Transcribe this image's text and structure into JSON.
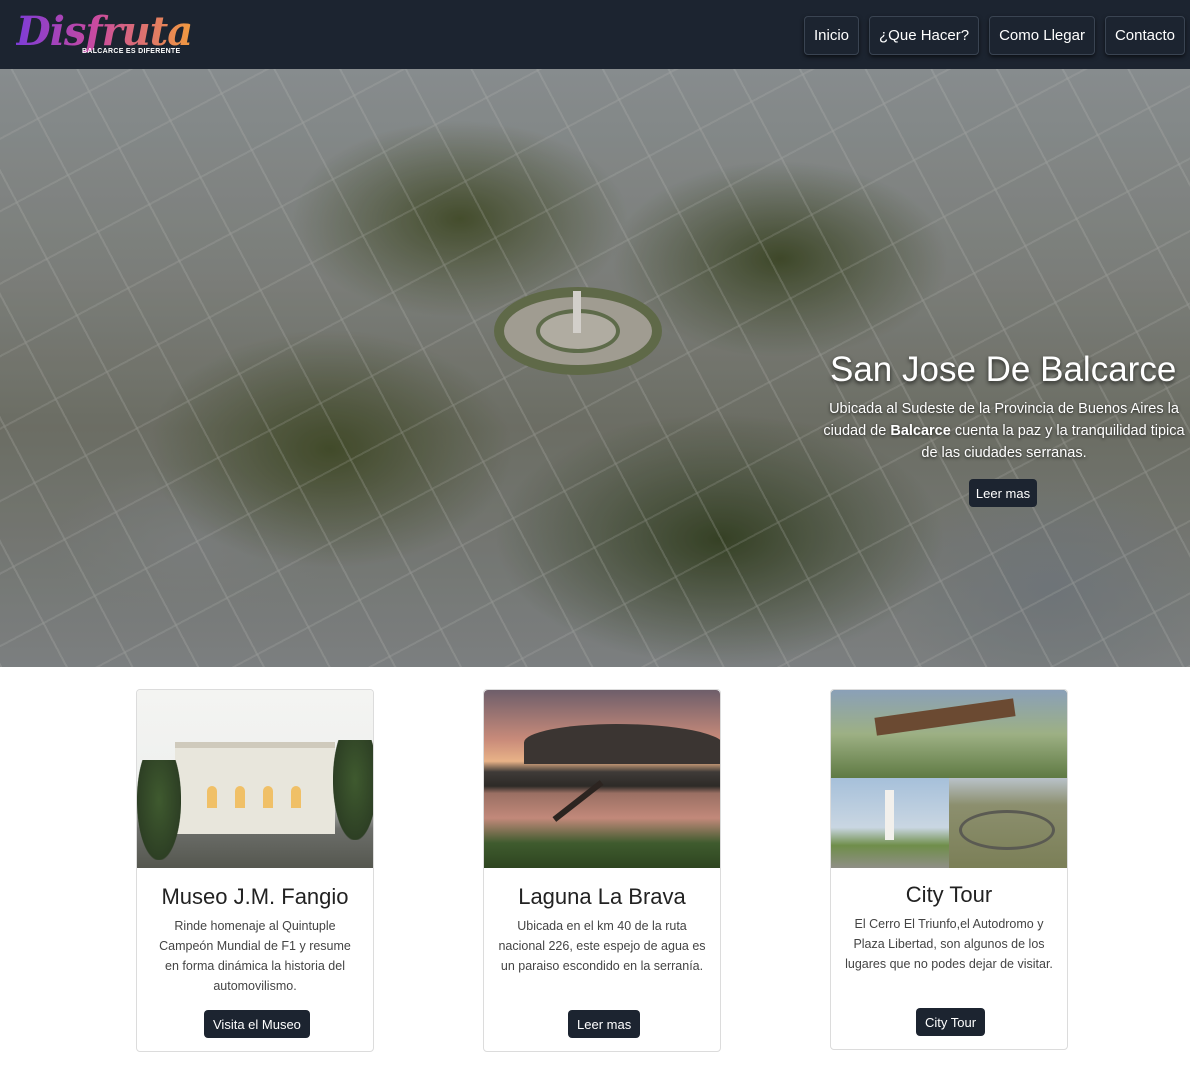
{
  "navbar": {
    "logo_text": "Disfruta",
    "logo_tagline": "BALCARCE ES DIFERENTE",
    "links": [
      "Inicio",
      "¿Que Hacer?",
      "Como Llegar",
      "Contacto"
    ]
  },
  "hero": {
    "title": "San Jose De Balcarce",
    "text_before": "Ubicada al Sudeste de la Provincia de Buenos Aires la ciudad de ",
    "text_bold": "Balcarce",
    "text_after": " cuenta la paz y la tranquilidad tipica de las ciudades serranas.",
    "button": "Leer mas"
  },
  "cards": [
    {
      "title": "Museo J.M. Fangio",
      "text": "Rinde homenaje al Quintuple Campeón Mundial de F1 y resume en forma dinámica la historia del automovilismo.",
      "button": "Visita el Museo"
    },
    {
      "title": "Laguna La Brava",
      "text": "Ubicada en el km 40 de la ruta nacional 226, este espejo de agua es un paraiso escondido en la serranía.",
      "button": "Leer mas"
    },
    {
      "title": "City Tour",
      "text": "El Cerro El Triunfo,el Autodromo y Plaza Libertad, son algunos de los lugares que no podes dejar de visitar.",
      "button": "City Tour"
    }
  ],
  "colors": {
    "navbar_bg": "#1c2430",
    "button_bg": "#1c2430",
    "text_dark": "#222222"
  }
}
